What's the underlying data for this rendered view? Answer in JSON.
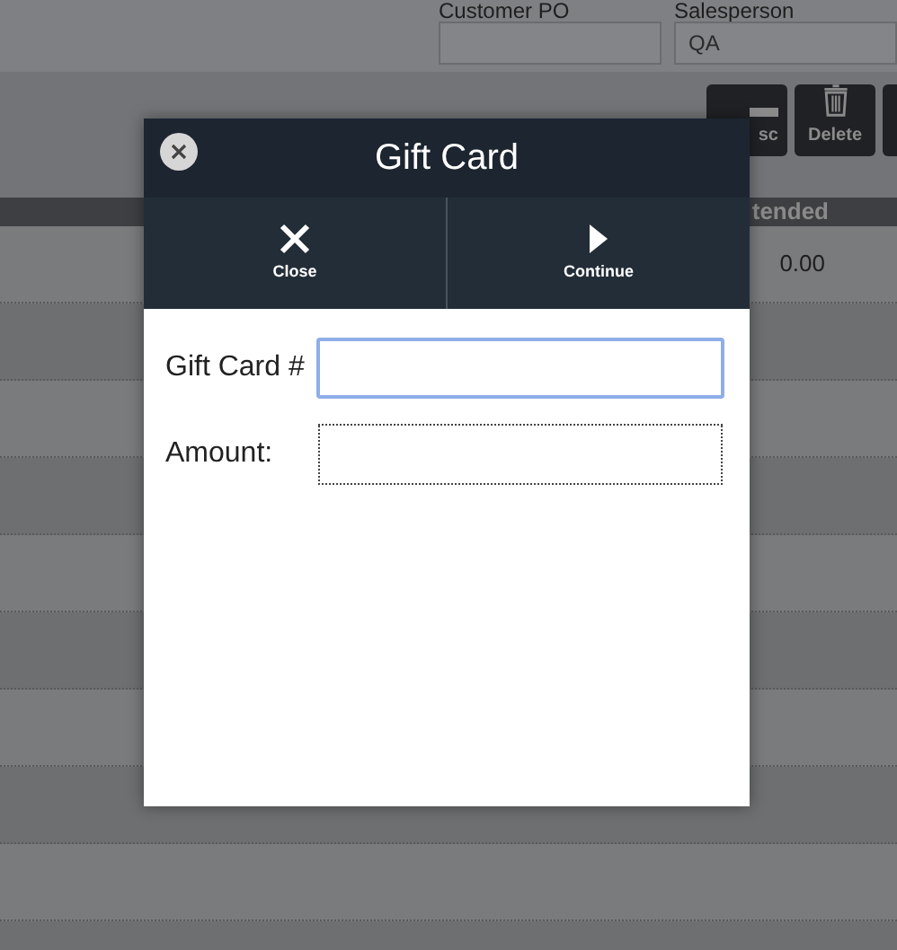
{
  "header_fields": [
    {
      "label": "Customer PO"
    },
    {
      "label": "Salesperson",
      "value": "QA"
    }
  ],
  "toolbar_buttons": [
    {
      "label": "sc",
      "kind": "minus"
    },
    {
      "label": "Delete",
      "kind": "trash"
    },
    {
      "kind": "blank"
    }
  ],
  "table": {
    "column_header": "tended",
    "rows": [
      {
        "value": "0.00"
      }
    ]
  },
  "dialog": {
    "title": "Gift Card",
    "actions": [
      {
        "label": "Close",
        "kind": "close"
      },
      {
        "label": "Continue",
        "kind": "continue"
      }
    ],
    "fields": [
      {
        "label": "Gift Card #",
        "focused": true
      },
      {
        "label": "Amount:",
        "focused": false
      }
    ]
  }
}
